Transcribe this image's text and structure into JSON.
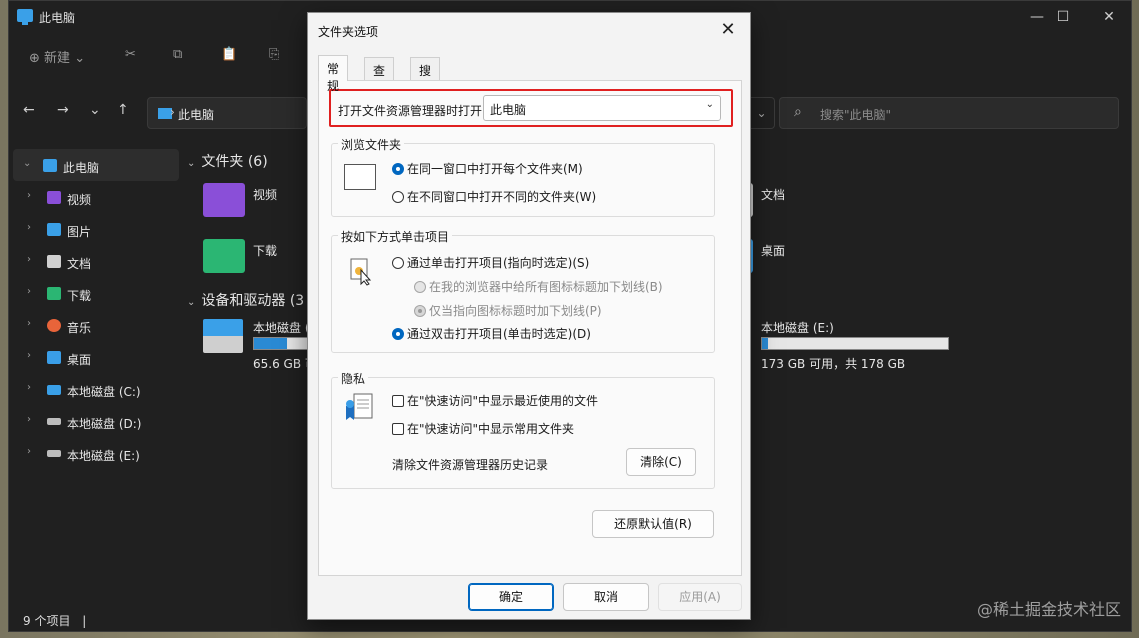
{
  "explorer": {
    "title": "此电脑",
    "toolbar": {
      "new_label": "新建",
      "new_plus": "⊕",
      "cut": "✂",
      "copy": "⧉",
      "paste": "📋",
      "rename": "⎘"
    },
    "window_controls": {
      "minimize": "—",
      "maximize": "☐",
      "close": "✕"
    },
    "nav": {
      "back": "←",
      "forward": "→",
      "recent": "⌄",
      "up": "↑"
    },
    "address": {
      "path": "此电脑",
      "chevron": "›",
      "dropdown": "⌄"
    },
    "search": {
      "placeholder": "搜索\"此电脑\"",
      "icon": "⌕"
    },
    "sidebar": {
      "items": [
        {
          "label": "此电脑",
          "icon_color": "#3aa0e8"
        },
        {
          "label": "视频",
          "icon_color": "#8a4fd8"
        },
        {
          "label": "图片",
          "icon_color": "#3aa0e8"
        },
        {
          "label": "文档",
          "icon_color": "#d0d0d0"
        },
        {
          "label": "下载",
          "icon_color": "#2bb673"
        },
        {
          "label": "音乐",
          "icon_color": "#e8643a"
        },
        {
          "label": "桌面",
          "icon_color": "#3a9ee8"
        },
        {
          "label": "本地磁盘 (C:)",
          "icon_color": "#3aa0e8"
        },
        {
          "label": "本地磁盘 (D:)",
          "icon_color": "#bdbdbd"
        },
        {
          "label": "本地磁盘 (E:)",
          "icon_color": "#bdbdbd"
        }
      ],
      "expand_glyph": "›",
      "collapse_glyph": "⌄"
    },
    "folders_section": "文件夹 (6)",
    "folders": [
      {
        "label": "视频",
        "color": "#8a4fd8"
      },
      {
        "label": "下载",
        "color": "#2bb673"
      },
      {
        "label": "文档",
        "color": "#d0d0d0"
      },
      {
        "label": "桌面",
        "color": "#3a9ee8"
      }
    ],
    "devices_section": "设备和驱动器 (3",
    "drives": [
      {
        "label": "本地磁盘 (",
        "info": "65.6 GB 可",
        "used_fraction": 0.62
      },
      {
        "label": "本地磁盘 (E:)",
        "info": "173 GB 可用，共 178 GB",
        "used_fraction": 0.03
      }
    ],
    "status": "9 个项目",
    "status_sep": "|"
  },
  "watermark": "@稀土掘金技术社区",
  "dialog": {
    "title": "文件夹选项",
    "close": "✕",
    "tabs": [
      "常规",
      "查看",
      "搜索"
    ],
    "open_label": "打开文件资源管理器时打开:",
    "open_value": "此电脑",
    "dropdown_glyph": "⌄",
    "browse": {
      "title": "浏览文件夹",
      "opt_same": "在同一窗口中打开每个文件夹(M)",
      "opt_diff": "在不同窗口中打开不同的文件夹(W)"
    },
    "click": {
      "title": "按如下方式单击项目",
      "opt_single": "通过单击打开项目(指向时选定)(S)",
      "sub_all": "在我的浏览器中给所有图标标题加下划线(B)",
      "sub_point": "仅当指向图标标题时加下划线(P)",
      "opt_double": "通过双击打开项目(单击时选定)(D)"
    },
    "privacy": {
      "title": "隐私",
      "recent_files": "在\"快速访问\"中显示最近使用的文件",
      "frequent_folders": "在\"快速访问\"中显示常用文件夹",
      "clear_label": "清除文件资源管理器历史记录",
      "clear_btn": "清除(C)"
    },
    "restore_btn": "还原默认值(R)",
    "ok_btn": "确定",
    "cancel_btn": "取消",
    "apply_btn": "应用(A)"
  }
}
